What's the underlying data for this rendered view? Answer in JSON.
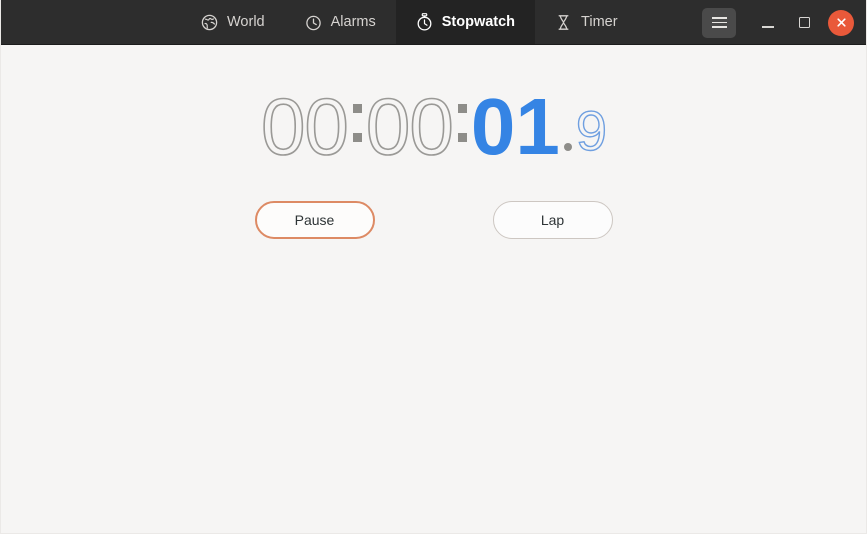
{
  "window": {
    "title": "Clock",
    "background_color": "#f6f5f4",
    "headerbar_color": "#2d2d2d"
  },
  "header": {
    "tabs": [
      {
        "id": "world",
        "label": "World",
        "icon": "globe-icon",
        "active": false
      },
      {
        "id": "alarms",
        "label": "Alarms",
        "icon": "alarm-clock-icon",
        "active": false
      },
      {
        "id": "stopwatch",
        "label": "Stopwatch",
        "icon": "stopwatch-icon",
        "active": true
      },
      {
        "id": "timer",
        "label": "Timer",
        "icon": "hourglass-icon",
        "active": false
      }
    ],
    "menu_button": {
      "icon": "hamburger-menu-icon",
      "label": "Main Menu"
    },
    "window_controls": [
      {
        "id": "minimize",
        "icon": "minimize-icon",
        "label": "Minimize"
      },
      {
        "id": "maximize",
        "icon": "maximize-icon",
        "label": "Maximize"
      },
      {
        "id": "close",
        "icon": "close-icon",
        "label": "Close",
        "color": "#e9593a"
      }
    ]
  },
  "stopwatch": {
    "hours": "00",
    "minutes": "00",
    "seconds": "01",
    "fraction": "9",
    "separator": ":",
    "decimal": ".",
    "elapsed_text": "00:00:01.9",
    "running": true,
    "accent_color": "#3584e4",
    "dim_color": "#9a9996",
    "buttons": {
      "primary_label": "Pause",
      "secondary_label": "Lap",
      "focus_ring_color": "#dd8a64"
    },
    "laps": []
  }
}
